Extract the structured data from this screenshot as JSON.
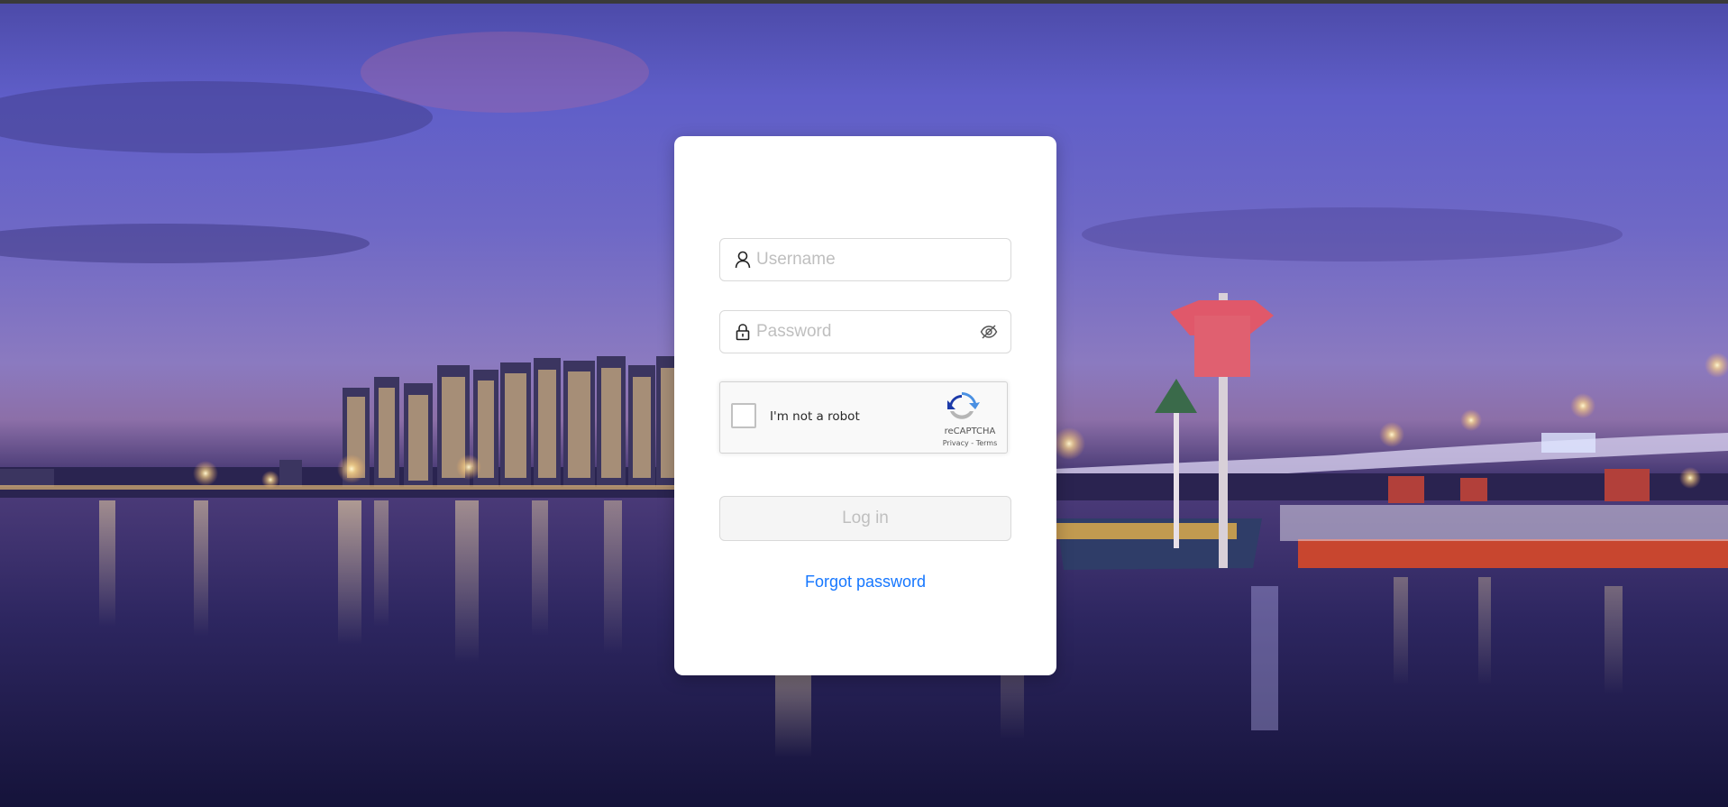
{
  "background": {
    "description_icon": "night-city-river-photo"
  },
  "login": {
    "username": {
      "placeholder": "Username",
      "icon": "user-icon"
    },
    "password": {
      "placeholder": "Password",
      "icon": "lock-icon",
      "toggle_icon": "eye-off-icon"
    },
    "recaptcha": {
      "label": "I'm not a robot",
      "brand": "reCAPTCHA",
      "privacy": "Privacy",
      "separator": " - ",
      "terms": "Terms"
    },
    "submit_label": "Log in",
    "forgot_label": "Forgot password"
  },
  "colors": {
    "link": "#1677ff",
    "disabled_button_bg": "#f5f5f5",
    "disabled_button_text": "#bfbfbf"
  }
}
